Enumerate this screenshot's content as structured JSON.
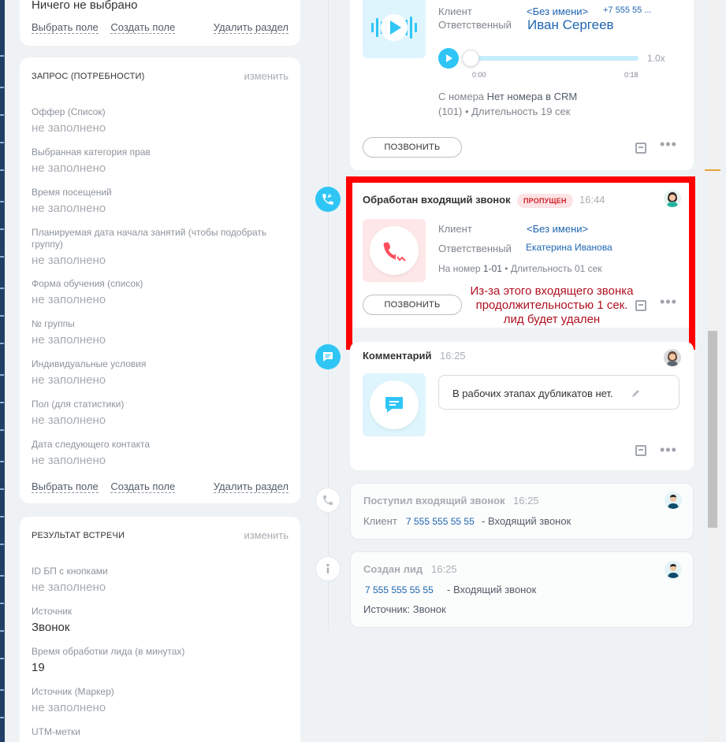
{
  "colors": {
    "accent": "#2fc6f6",
    "link": "#2066b0",
    "missed": "#d2232a",
    "annotation": "#ff0000"
  },
  "left_top_card": {
    "value": "Ничего не выбрано",
    "select_field": "Выбрать поле",
    "create_field": "Создать поле",
    "delete_section": "Удалить раздел"
  },
  "request_section": {
    "title": "ЗАПРОС (ПОТРЕБНОСТИ)",
    "edit": "изменить",
    "fields": [
      {
        "label": "Оффер (Список)",
        "value": "не заполнено"
      },
      {
        "label": "Выбранная категория прав",
        "value": "не заполнено"
      },
      {
        "label": "Время посещений",
        "value": "не заполнено"
      },
      {
        "label": "Планируемая дата начала занятий (чтобы подобрать группу)",
        "value": "не заполнено"
      },
      {
        "label": "Форма обучения (список)",
        "value": "не заполнено"
      },
      {
        "label": "№ группы",
        "value": "не заполнено"
      },
      {
        "label": "Индивидуальные условия",
        "value": "не заполнено"
      },
      {
        "label": "Пол (для статистики)",
        "value": "не заполнено"
      },
      {
        "label": "Дата следующего контакта",
        "value": "не заполнено"
      }
    ],
    "select_field": "Выбрать поле",
    "create_field": "Создать поле",
    "delete_section": "Удалить раздел"
  },
  "result_section": {
    "title": "РЕЗУЛЬТАТ ВСТРЕЧИ",
    "edit": "изменить",
    "fields": [
      {
        "label": "ID БП с кнопками",
        "value": "не заполнено"
      },
      {
        "label": "Источник",
        "value": "Звонок"
      },
      {
        "label": "Время обработки лида (в минутах)",
        "value": "19"
      },
      {
        "label": "Источник (Маркер)",
        "value": "не заполнено"
      },
      {
        "label": "UTM-метки",
        "value": ""
      }
    ]
  },
  "call_card_top": {
    "client_label": "Клиент",
    "client_name": "<Без имени>",
    "client_phone": "+7 555 55 ...",
    "responsible_label": "Ответственный",
    "responsible_name": "Иван Сергеев",
    "speed": "1.0x",
    "time_start": "0:00",
    "time_end": "0:18",
    "from_number_label": "С номера",
    "from_number_value": "Нет номера в CRM",
    "line_and_duration": "(101) • Длительность 19 сек",
    "call_button": "ПОЗВОНИТЬ"
  },
  "missed_call_card": {
    "title": "Обработан входящий звонок",
    "badge": "ПРОПУЩЕН",
    "time": "16:44",
    "client_label": "Клиент",
    "client_name": "<Без имени>",
    "responsible_label": "Ответственный",
    "responsible_name": "Екатерина Иванова",
    "to_number_label": "На номер",
    "to_number_value": "1-01",
    "duration": "• Длительность 01 сек",
    "call_button": "ПОЗВОНИТЬ"
  },
  "annotation": {
    "lines": [
      "Из-за этого входящего звонка",
      "продолжительностью 1 сек.",
      "лид будет удален"
    ]
  },
  "comment_card": {
    "title": "Комментарий",
    "time": "16:25",
    "text": "В рабочих этапах дубликатов нет."
  },
  "incoming_call_card": {
    "title": "Поступил входящий звонок",
    "time": "16:25",
    "client_label": "Клиент",
    "phone": "7 555 555 55 55",
    "suffix": "- Входящий звонок"
  },
  "lead_created_card": {
    "title": "Создан лид",
    "time": "16:25",
    "phone": "7 555 555 55 55",
    "suffix": "- Входящий звонок",
    "source": "Источник: Звонок"
  }
}
